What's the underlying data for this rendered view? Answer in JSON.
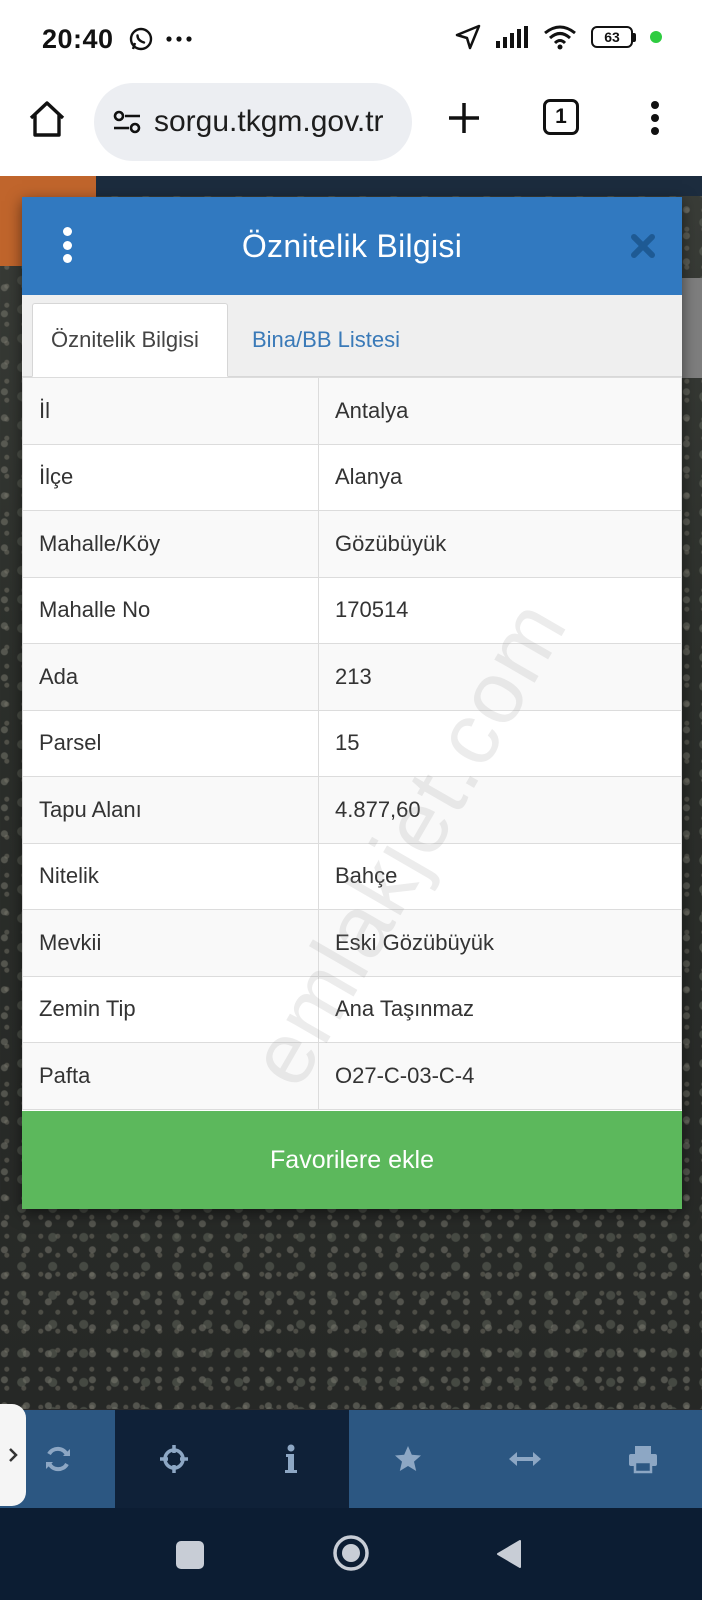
{
  "status_bar": {
    "time": "20:40",
    "battery_level": "63",
    "icons": [
      "whatsapp-icon",
      "more-dots-icon",
      "location-icon",
      "signal-icon",
      "wifi-icon",
      "battery-icon"
    ]
  },
  "browser": {
    "url": "sorgu.tkgm.gov.tr",
    "tab_count": "1",
    "icons": [
      "home-icon",
      "site-info-icon",
      "new-tab-icon",
      "tabs-icon",
      "menu-icon"
    ]
  },
  "dialog": {
    "title": "Öznitelik Bilgisi",
    "tabs": [
      {
        "label": "Öznitelik Bilgisi",
        "active": true
      },
      {
        "label": "Bina/BB Listesi",
        "active": false
      }
    ],
    "rows": [
      {
        "key": "İl",
        "value": "Antalya"
      },
      {
        "key": "İlçe",
        "value": "Alanya"
      },
      {
        "key": "Mahalle/Köy",
        "value": "Gözübüyük"
      },
      {
        "key": "Mahalle No",
        "value": "170514"
      },
      {
        "key": "Ada",
        "value": "213"
      },
      {
        "key": "Parsel",
        "value": "15"
      },
      {
        "key": "Tapu Alanı",
        "value": "4.877,60"
      },
      {
        "key": "Nitelik",
        "value": "Bahçe"
      },
      {
        "key": "Mevkii",
        "value": "Eski Gözübüyük"
      },
      {
        "key": "Zemin Tip",
        "value": "Ana Taşınmaz"
      },
      {
        "key": "Pafta",
        "value": "O27-C-03-C-4"
      }
    ],
    "favorite_button": "Favorilere ekle",
    "watermark": "emlakjet.com"
  },
  "toolbar": {
    "icons": [
      "refresh-icon",
      "crosshair-icon",
      "info-icon",
      "star-icon",
      "measure-icon",
      "print-icon"
    ]
  },
  "colors": {
    "header_blue": "#3179c0",
    "tab_link_blue": "#3a7ab8",
    "favorite_green": "#5cb85c",
    "toolbar_light": "#2c5782",
    "toolbar_dark": "#0f2138"
  }
}
